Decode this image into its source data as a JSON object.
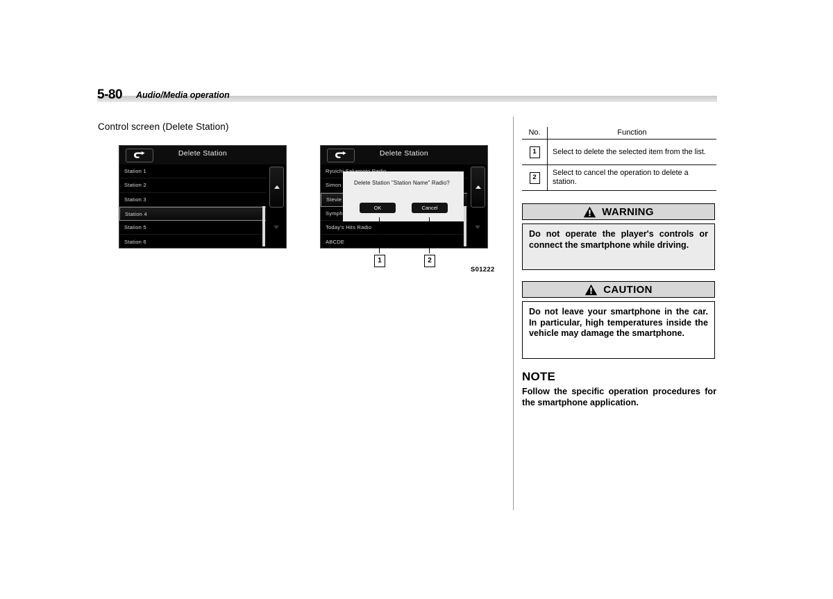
{
  "header": {
    "page_number": "5-80",
    "section_title": "Audio/Media operation"
  },
  "section_caption": "Control screen (Delete Station)",
  "figure_reference": "S01222",
  "screens": [
    {
      "name": "delete-station-list",
      "title": "Delete Station",
      "back_icon": "back-arrow-icon",
      "items": [
        {
          "label": "Station 1",
          "selected": false
        },
        {
          "label": "Station 2",
          "selected": false
        },
        {
          "label": "Station 3",
          "selected": false
        },
        {
          "label": "Station 4",
          "selected": true
        },
        {
          "label": "Station 5",
          "selected": false
        },
        {
          "label": "Station 6",
          "selected": false
        }
      ],
      "scroll_up_icon": "triangle-up-icon",
      "scroll_down_icon": "triangle-down-icon"
    },
    {
      "name": "delete-station-confirm",
      "title": "Delete Station",
      "back_icon": "back-arrow-icon",
      "items": [
        {
          "label": "Ryuichi Sakamoto Radio",
          "selected": false
        },
        {
          "label": "Simon",
          "selected": false
        },
        {
          "label": "Stevie",
          "selected": true
        },
        {
          "label": "Symph",
          "selected": false
        },
        {
          "label": "Today's Hits Radio",
          "selected": false
        },
        {
          "label": "ABCDE",
          "selected": false
        }
      ],
      "scroll_up_icon": "triangle-up-icon",
      "scroll_down_icon": "triangle-down-icon",
      "dialog": {
        "message": "Delete Station \"Station Name\" Radio?",
        "ok_label": "OK",
        "cancel_label": "Cancel"
      }
    }
  ],
  "callouts": [
    {
      "number": "1"
    },
    {
      "number": "2"
    }
  ],
  "function_table": {
    "columns": [
      "No.",
      "Function"
    ],
    "rows": [
      {
        "no": "1",
        "function": "Select to delete the selected item from the list."
      },
      {
        "no": "2",
        "function": "Select to cancel the operation to delete a station."
      }
    ]
  },
  "warning": {
    "icon": "warning-triangle-icon",
    "title": "WARNING",
    "text": "Do not operate the player's controls or connect the smartphone while driving."
  },
  "caution": {
    "icon": "caution-triangle-icon",
    "title": "CAUTION",
    "text": "Do not leave your smartphone in the car. In particular, high temperatures inside the vehicle may damage the smartphone."
  },
  "note": {
    "title": "NOTE",
    "text": "Follow the specific operation procedures for the smartphone application."
  },
  "colors": {
    "header_bar": "#d5d5d5",
    "screen_bg": "#000000",
    "dialog_bg": "#eeeeee",
    "alert_head_bg": "#d7d7d7",
    "warning_body_bg": "#ebebeb"
  }
}
